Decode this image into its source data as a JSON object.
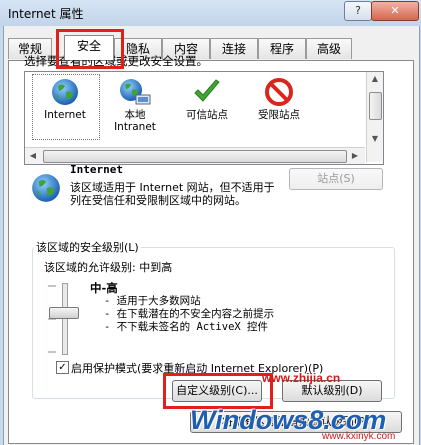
{
  "window": {
    "title": "Internet 属性",
    "help_label": "?",
    "close_label": "✕"
  },
  "tabs": [
    {
      "label": "常规"
    },
    {
      "label": "安全"
    },
    {
      "label": "隐私"
    },
    {
      "label": "内容"
    },
    {
      "label": "连接"
    },
    {
      "label": "程序"
    },
    {
      "label": "高级"
    }
  ],
  "active_tab": "安全",
  "zone_prompt": "选择要查看的区域或更改安全设置。",
  "zones": [
    {
      "label": "Internet",
      "icon": "globe-icon"
    },
    {
      "label": "本地\nIntranet",
      "icon": "intranet-globe-icon"
    },
    {
      "label": "可信站点",
      "icon": "checkmark-icon"
    },
    {
      "label": "受限站点",
      "icon": "prohibited-icon"
    }
  ],
  "selected_zone": {
    "name": "Internet",
    "description": "该区域适用于 Internet 网站，但不适用于列在受信任和受限制区域中的网站。",
    "sites_button": "站点(S)"
  },
  "security_level": {
    "group_label": "该区域的安全级别(L)",
    "allowed_levels": "该区域的允许级别: 中到高",
    "level_name": "中-高",
    "items": [
      "- 适用于大多数网站",
      "- 在下载潜在的不安全内容之前提示",
      "- 不下载未签名的 ActiveX 控件"
    ]
  },
  "protected_mode": {
    "checked": true,
    "label": "启用保护模式(要求重新启动 Internet Explorer)(P)"
  },
  "buttons": {
    "custom_level": "自定义级别(C)...",
    "default_level": "默认级别(D)",
    "reset_all": "将所有区域重置为默认级别(R)"
  },
  "watermark": {
    "site_top": "www.zhijia.cn",
    "brand": "Windows8.com",
    "site_bottom": "www.kxinyk.com"
  },
  "colors": {
    "highlight_red": "#e0201b",
    "watermark_red": "#cc1a1a",
    "watermark_blue": "#1f5fb0"
  }
}
